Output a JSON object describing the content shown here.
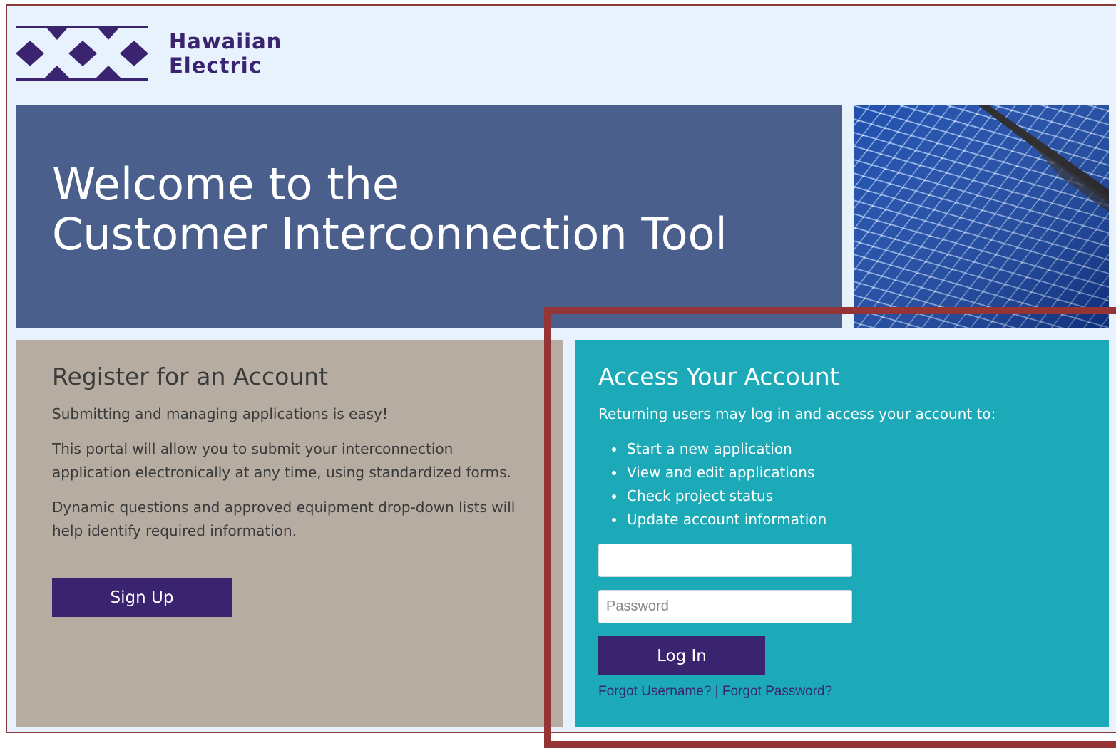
{
  "brand": {
    "name_line1": "Hawaiian",
    "name_line2": "Electric",
    "logo_icon": "hawaiian-electric-diamond-logo",
    "color": "#3a2470"
  },
  "hero": {
    "title_line1": "Welcome to the",
    "title_line2": "Customer Interconnection Tool",
    "background": "#4a5f8c",
    "image": "solar-panels-photo"
  },
  "register": {
    "title": "Register for an Account",
    "text1": "Submitting and managing applications is easy!",
    "text2": "This portal will allow you to submit your interconnection application electronically at any time, using standardized forms.",
    "text3": "Dynamic questions and approved equipment drop-down lists will help identify required information.",
    "signup_label": "Sign Up",
    "background": "#b6aca1"
  },
  "access": {
    "title": "Access Your Account",
    "intro": "Returning users may log in and access your account to:",
    "items": [
      "Start a new application",
      "View and edit applications",
      "Check project status",
      "Update account information"
    ],
    "username_value": "",
    "username_placeholder": "",
    "password_placeholder": "Password",
    "login_label": "Log In",
    "forgot_username": "Forgot Username?",
    "separator": " | ",
    "forgot_password": "Forgot Password?",
    "background": "#1daab8"
  },
  "colors": {
    "page_background": "#e8f2fc",
    "button": "#3a2470",
    "highlight": "#943434"
  }
}
